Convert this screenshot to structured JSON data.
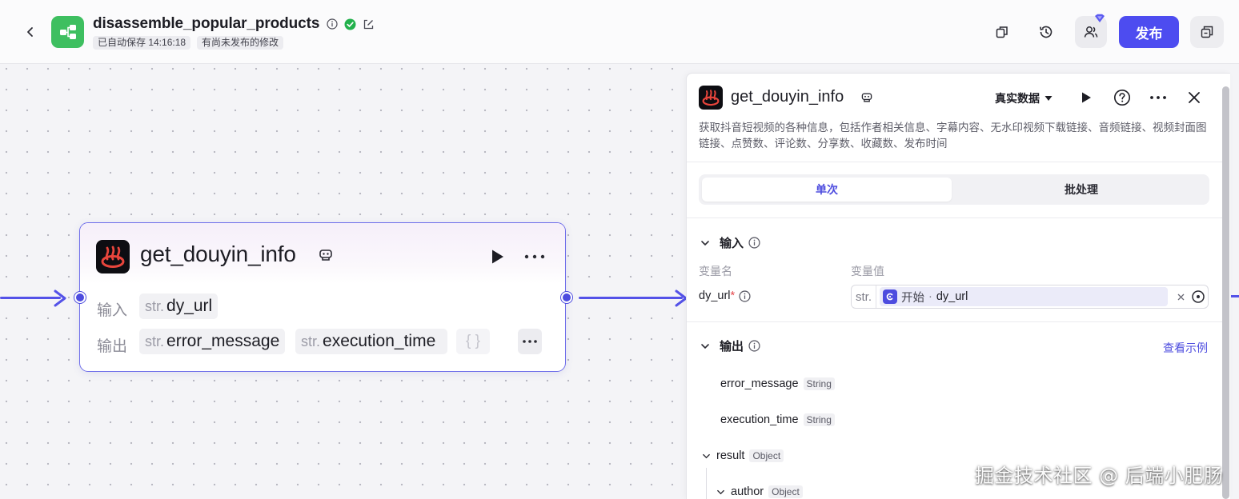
{
  "header": {
    "title": "disassemble_popular_products",
    "autosave": "已自动保存 14:16:18",
    "unpublished": "有尚未发布的修改",
    "publish_label": "发布"
  },
  "node": {
    "title": "get_douyin_info",
    "input_label": "输入",
    "output_label": "输出",
    "inputs": [
      {
        "type": "str.",
        "name": "dy_url"
      }
    ],
    "outputs": [
      {
        "type": "str.",
        "name": "error_message"
      },
      {
        "type": "str.",
        "name": "execution_time"
      }
    ],
    "object_glyph": "{ }"
  },
  "panel": {
    "title": "get_douyin_info",
    "data_mode": "真实数据",
    "description": "获取抖音短视频的各种信息，包括作者相关信息、字幕内容、无水印视频下载链接、音频链接、视频封面图链接、点赞数、评论数、分享数、收藏数、发布时间",
    "tabs": [
      "单次",
      "批处理"
    ],
    "input_section": "输入",
    "col_var_name": "变量名",
    "col_var_value": "变量值",
    "input_var": {
      "name": "dy_url",
      "required_mark": "*",
      "type": "str.",
      "ref_source": "开始",
      "ref_sep": "·",
      "ref_field": "dy_url"
    },
    "output_section": "输出",
    "see_example": "查看示例",
    "outputs": [
      {
        "name": "error_message",
        "type": "String"
      },
      {
        "name": "execution_time",
        "type": "String"
      },
      {
        "name": "result",
        "type": "Object"
      },
      {
        "name": "author",
        "type": "Object"
      }
    ]
  },
  "watermark": "掘金技术社区 @ 后端小肥肠",
  "colors": {
    "accent": "#4d4cf0",
    "app_icon": "#3ebf60",
    "edge": "#5452e8"
  }
}
